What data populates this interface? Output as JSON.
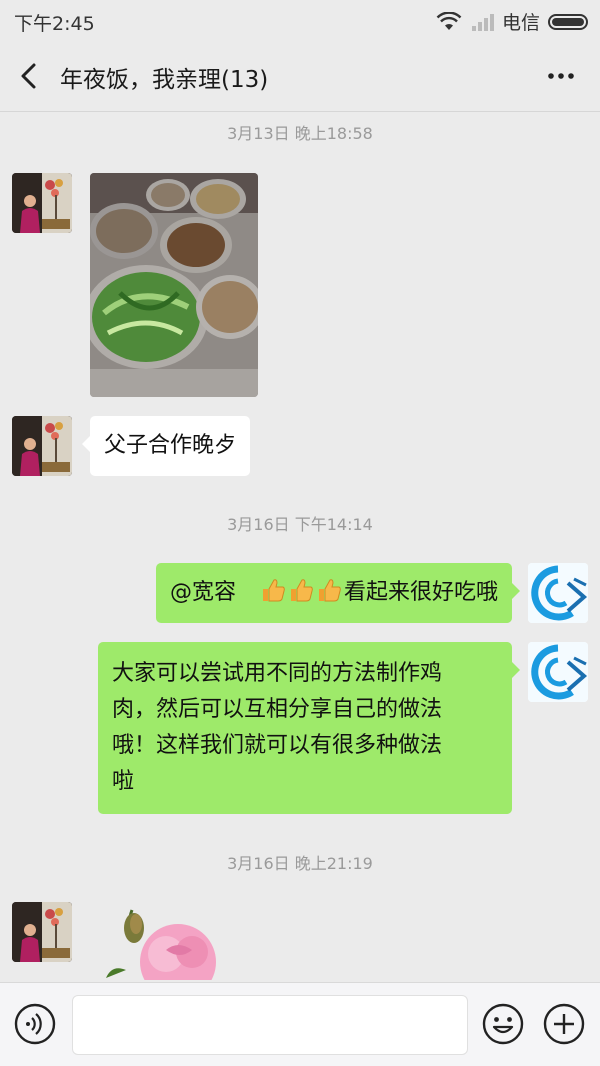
{
  "status_bar": {
    "time": "下午2:45",
    "carrier": "电信"
  },
  "header": {
    "title": "年夜饭，我亲理(13)"
  },
  "messages": [
    {
      "type": "time",
      "text": "3月13日 晚上18:58"
    },
    {
      "type": "image",
      "side": "left",
      "icon": "photo-of-dishes"
    },
    {
      "type": "text",
      "side": "left",
      "text": "父子合作晚歺"
    },
    {
      "type": "time",
      "text": "3月16日 下午14:14"
    },
    {
      "type": "text",
      "side": "right",
      "mention": "@宽容",
      "thumbs": 3,
      "text": "看起来很好吃哦"
    },
    {
      "type": "text",
      "side": "right",
      "lines": [
        "大家可以尝试用不同的方法制作鸡",
        "肉，然后可以互相分享自己的做法",
        "哦！这样我们就可以有很多种做法",
        "啦"
      ]
    },
    {
      "type": "time",
      "text": "3月16日 晚上21:19"
    },
    {
      "type": "sticker",
      "side": "left",
      "icon": "pink-rose-sticker"
    }
  ],
  "colors": {
    "bubble_green": "#9eea6a",
    "bubble_white": "#ffffff",
    "background": "#ebebeb",
    "timestamp": "#9a9a9a"
  },
  "input_bar": {
    "placeholder": "",
    "icons": [
      "voice-icon",
      "emoji-icon",
      "plus-icon"
    ]
  }
}
